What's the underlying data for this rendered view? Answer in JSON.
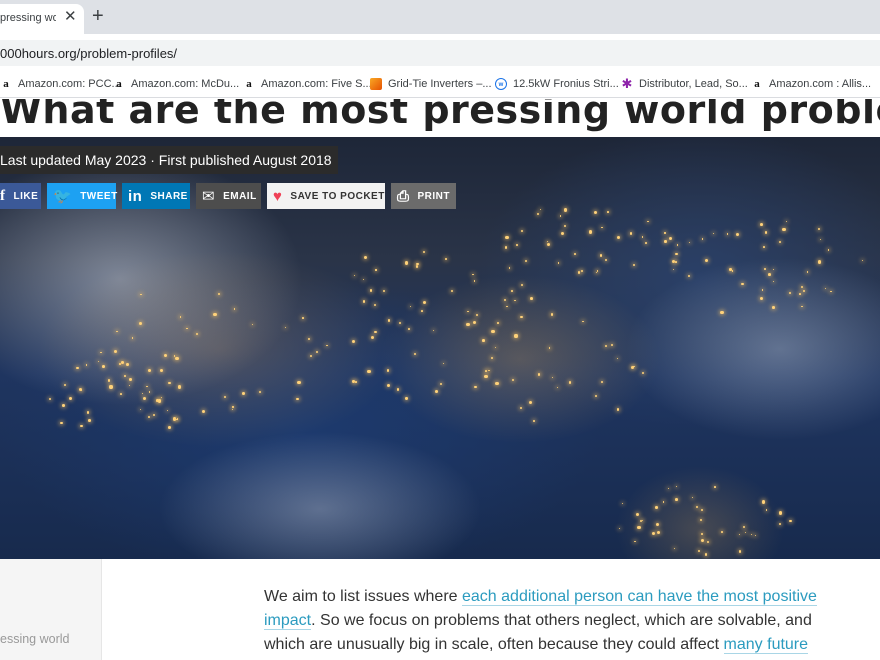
{
  "browser": {
    "tab": {
      "title": "pressing wo",
      "close_glyph": "✕"
    },
    "new_tab_glyph": "+",
    "url": "000hours.org/problem-profiles/",
    "bookmarks": [
      {
        "icon": "amazon-icon",
        "label": "Amazon.com: PCC..."
      },
      {
        "icon": "amazon-icon",
        "label": "Amazon.com: McDu..."
      },
      {
        "icon": "amazon-icon",
        "label": "Amazon.com: Five S..."
      },
      {
        "icon": "solar-icon",
        "label": "Grid-Tie Inverters –..."
      },
      {
        "icon": "fronius-icon",
        "label": "12.5kW Fronius Stri..."
      },
      {
        "icon": "star-icon",
        "label": "Distributor, Lead, So..."
      },
      {
        "icon": "amazon-icon",
        "label": "Amazon.com : Allis..."
      }
    ]
  },
  "article": {
    "title": "What are the most pressing world problems?",
    "updated": "Last updated May 2023 · First published August 2018",
    "share": {
      "facebook": "LIKE",
      "twitter": "TWEET",
      "linkedin": "SHARE",
      "email": "EMAIL",
      "pocket": "SAVE TO POCKET",
      "print": "PRINT"
    },
    "sidebar_text": "essing world",
    "intro": {
      "t1": "We aim to list issues where ",
      "link1": "each additional person can have the most positive impact",
      "t2": ". So we focus on problems that others neglect, which are solvable, and which are unusually big in scale, often because they could affect ",
      "link2": "many future"
    }
  },
  "colors": {
    "facebook": "#3b5998",
    "twitter": "#1da1f2",
    "linkedin": "#0077b5",
    "pocket": "#ef4056",
    "link": "#2b9bbf"
  }
}
